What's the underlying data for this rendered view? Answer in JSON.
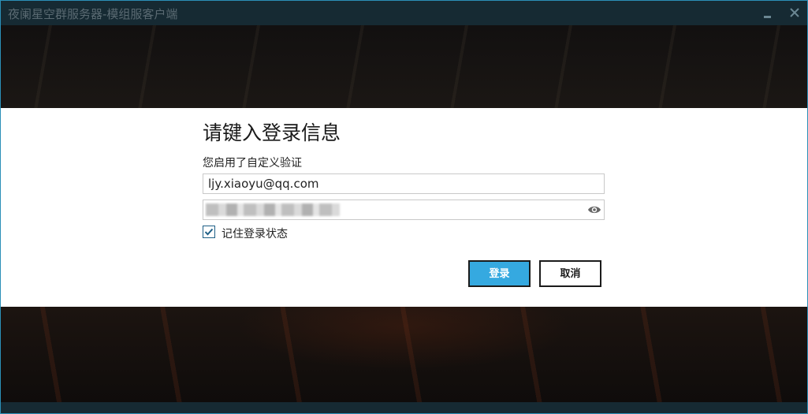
{
  "window": {
    "title": "夜阑星空群服务器-模组服客户端"
  },
  "dialog": {
    "title": "请键入登录信息",
    "subtitle": "您启用了自定义验证",
    "email_value": "ljy.xiaoyu@qq.com",
    "password_masked": true,
    "remember_label": "记住登录状态",
    "remember_checked": true,
    "login_label": "登录",
    "cancel_label": "取消"
  },
  "icons": {
    "minimize": "minimize-icon",
    "close": "close-icon",
    "eye": "eye-icon",
    "check": "checkmark-icon"
  },
  "colors": {
    "accent": "#35a9e0",
    "titlebar": "#162a33",
    "window_border": "#2b90b8"
  }
}
